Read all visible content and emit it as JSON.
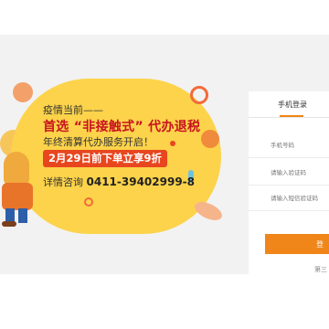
{
  "banner": {
    "line1": "疫情当前——",
    "line2": "首选 “非接触式” 代办退税",
    "line3": "年终清算代办服务开启！",
    "promo": "2月29日前下单立享9折",
    "contact_label": "详情咨询",
    "contact_phone": "0411-39402999-8",
    "accent_color": "#fcd34a",
    "highlight_color": "#c8141f"
  },
  "login": {
    "tab": "手机登录",
    "phone_placeholder": "手机号码",
    "captcha_placeholder": "请输入验证码",
    "sms_placeholder": "请输入短信验证码",
    "submit_label": "登",
    "third_party_label": "第三",
    "accent_color": "#f08519"
  }
}
